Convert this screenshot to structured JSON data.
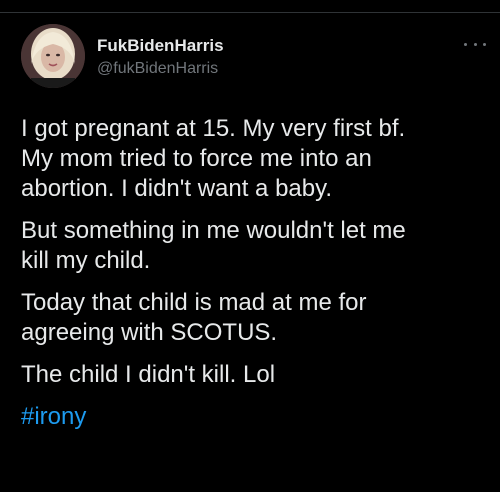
{
  "user": {
    "display_name": "FukBidenHarris",
    "handle": "@fukBidenHarris"
  },
  "tweet": {
    "paragraphs": [
      "I got pregnant at 15. My very first bf.\nMy mom tried to force me into an\nabortion. I didn't want a baby.",
      "But something in me wouldn't let me\nkill my child.",
      "Today that child is mad at me for\nagreeing with SCOTUS.",
      "The child I didn't kill.  Lol"
    ],
    "hashtag": "#irony"
  },
  "icons": {
    "more": "more-options-icon",
    "avatar": "profile-avatar"
  },
  "colors": {
    "background": "#000000",
    "text": "#e7e9ea",
    "secondary_text": "#71767b",
    "link": "#1d9bf0"
  }
}
